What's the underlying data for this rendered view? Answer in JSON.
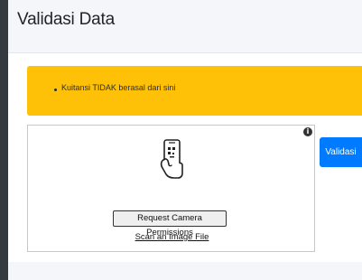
{
  "header": {
    "title": "Validasi Data"
  },
  "alert": {
    "items": [
      "Kuitansi TIDAK berasal dari sini"
    ]
  },
  "scanner": {
    "request_button_label": "Request Camera Permissions",
    "scan_link_label": "Scan an Image File",
    "info_icon": "info-icon",
    "main_icon": "phone-scan-icon"
  },
  "actions": {
    "validasi_label": "Validasi"
  },
  "colors": {
    "alert_bg": "#ffc107",
    "primary": "#007bff",
    "sidebar": "#343a40",
    "page_bg": "#f4f6f9"
  }
}
